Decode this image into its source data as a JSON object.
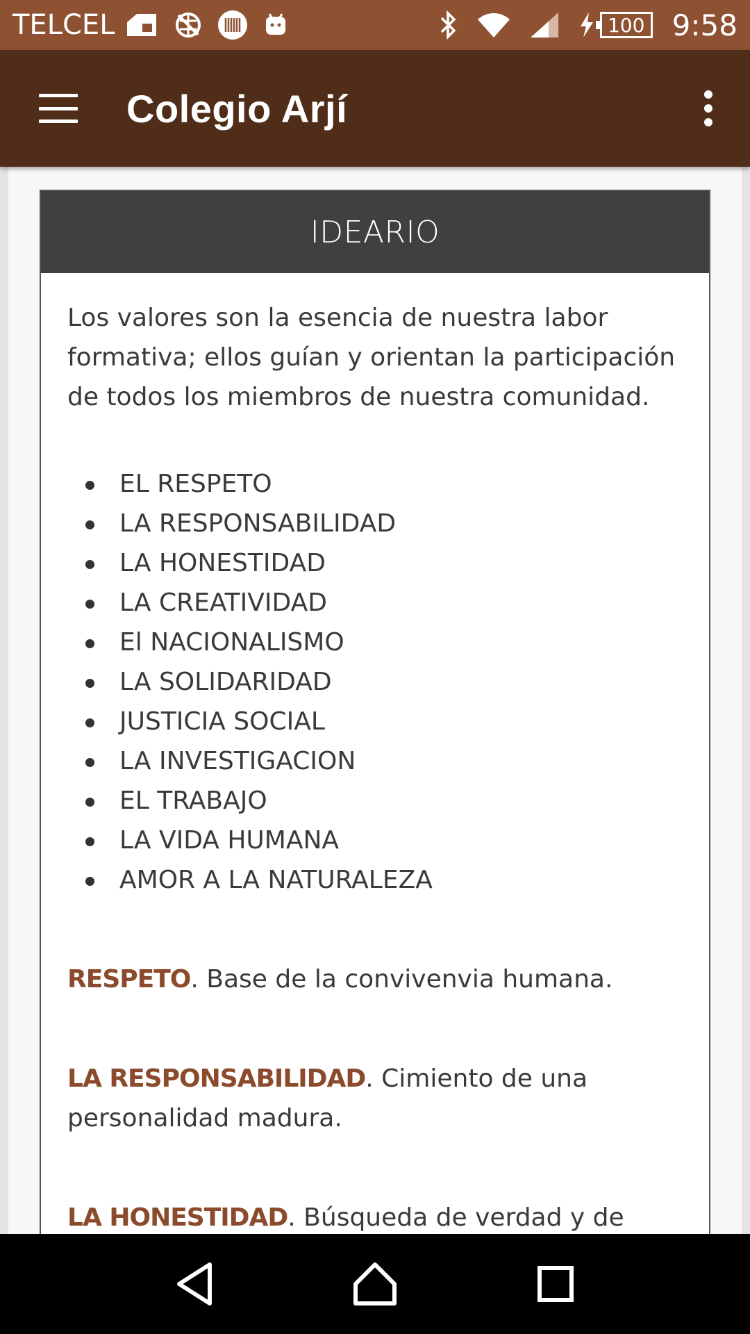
{
  "status_bar": {
    "carrier": "TELCEL",
    "battery": "100",
    "time": "9:58",
    "icons": [
      "sim-card-icon",
      "no-network-icon",
      "barcode-icon",
      "android-icon",
      "bluetooth-icon",
      "wifi-icon",
      "cell-signal-icon",
      "charging-icon"
    ]
  },
  "app_bar": {
    "title": "Colegio Arjí",
    "menu_icon": "hamburger-menu-icon",
    "overflow_icon": "more-vert-icon",
    "background": "#502d18"
  },
  "card": {
    "header": "IDEARIO",
    "intro": "Los valores son la esencia de nuestra labor formativa; ellos guían y orientan la participación de todos los miembros de nuestra comunidad.",
    "values": [
      "EL RESPETO",
      "LA RESPONSABILIDAD",
      "LA HONESTIDAD",
      "LA CREATIVIDAD",
      "El NACIONALISMO",
      "LA SOLIDARIDAD",
      "JUSTICIA SOCIAL",
      "LA INVESTIGACION",
      "EL TRABAJO",
      "LA VIDA HUMANA",
      "AMOR A LA NATURALEZA"
    ],
    "definitions": [
      {
        "term": "RESPETO",
        "text": ". Base de la convivenvia humana."
      },
      {
        "term": "LA RESPONSABILIDAD",
        "text": ". Cimiento de una personalidad madura."
      },
      {
        "term": "LA HONESTIDAD",
        "text": ". Búsqueda de verdad y de"
      }
    ],
    "term_color": "#8b4a2b",
    "header_background": "#404040"
  },
  "nav_bar": {
    "buttons": [
      "back-icon",
      "home-icon",
      "recents-icon"
    ]
  }
}
